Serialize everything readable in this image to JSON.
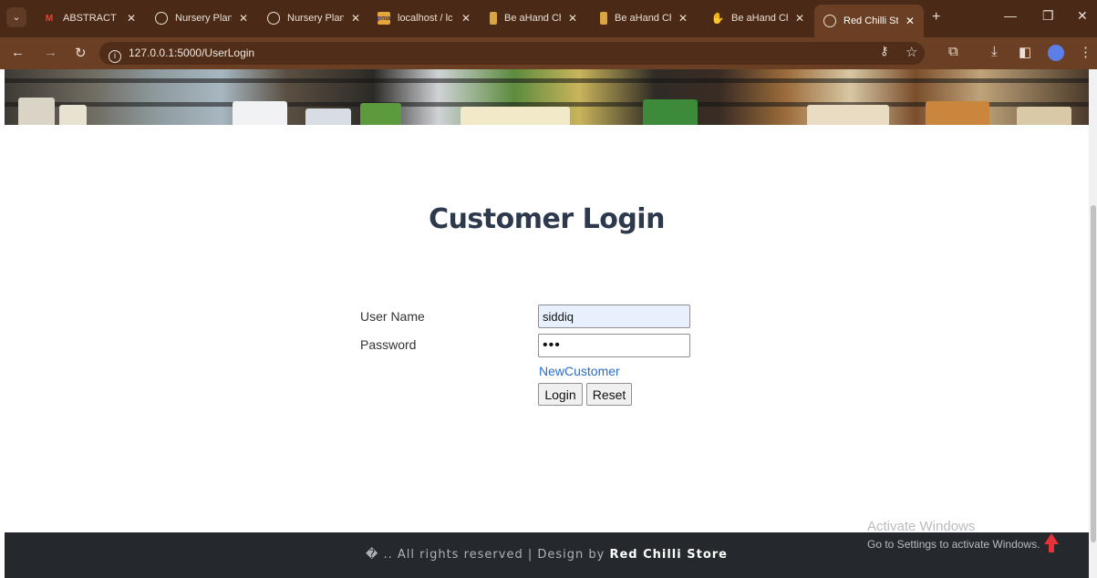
{
  "browser": {
    "tabs": [
      {
        "title": "ABSTRACT -",
        "icon": "gmail-icon"
      },
      {
        "title": "Nursery Plan",
        "icon": "globe-icon"
      },
      {
        "title": "Nursery Plan",
        "icon": "globe-icon"
      },
      {
        "title": "localhost / lc",
        "icon": "phpmyadmin-icon"
      },
      {
        "title": "Be aHand Ch",
        "icon": "document-icon"
      },
      {
        "title": "Be aHand Ch",
        "icon": "document-icon"
      },
      {
        "title": "Be aHand Ch",
        "icon": "hand-icon"
      },
      {
        "title": "Red Chilli Sto",
        "icon": "globe-icon",
        "active": true
      }
    ],
    "url": "127.0.0.1:5000/UserLogin"
  },
  "page": {
    "heading": "Customer Login",
    "form": {
      "username_label": "User Name",
      "username_value": "siddiq",
      "password_label": "Password",
      "password_value": "•••",
      "new_customer_link": "NewCustomer",
      "login_button": "Login",
      "reset_button": "Reset"
    },
    "footer": {
      "prefix": "� .. All rights reserved | Design by",
      "brand": "Red Chilli Store"
    }
  },
  "overlay": {
    "watermark_title": "Activate Windows",
    "watermark_sub": "Go to Settings to activate Windows."
  },
  "colors": {
    "tabbar": "#4a2a17",
    "addrbar": "#6b3f24",
    "heading": "#2d3a4d",
    "link": "#2a6ec7",
    "footer": "#25282c",
    "autofill": "#e8f0fe"
  }
}
